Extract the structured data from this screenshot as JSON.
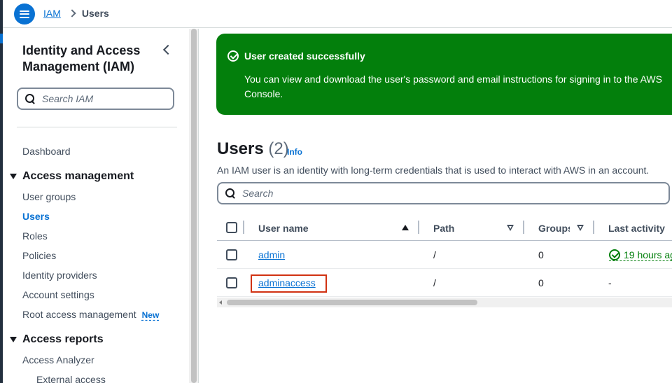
{
  "breadcrumb": {
    "root": "IAM",
    "current": "Users"
  },
  "sidebar": {
    "title": "Identity and Access Management (IAM)",
    "search_placeholder": "Search IAM",
    "dashboard": "Dashboard",
    "access_management": {
      "label": "Access management",
      "items": [
        "User groups",
        "Users",
        "Roles",
        "Policies",
        "Identity providers",
        "Account settings",
        "Root access management"
      ],
      "active": "Users",
      "new_badge": "New"
    },
    "access_reports": {
      "label": "Access reports",
      "items": [
        "Access Analyzer",
        "External access"
      ]
    }
  },
  "flash": {
    "title": "User created successfully",
    "body": "You can view and download the user's password and email instructions for signing in to the AWS Console.",
    "color": "#037f0c"
  },
  "users": {
    "title": "Users",
    "count": "(2)",
    "info": "Info",
    "description": "An IAM user is an identity with long-term credentials that is used to interact with AWS in an account.",
    "search_placeholder": "Search",
    "columns": [
      "User name",
      "Path",
      "Groups",
      "Last activity"
    ],
    "rows": [
      {
        "user_name": "admin",
        "path": "/",
        "groups": "0",
        "last_activity": "19 hours ag"
      },
      {
        "user_name": "adminaccess",
        "path": "/",
        "groups": "0",
        "last_activity": "-"
      }
    ]
  },
  "colors": {
    "accent": "#0972d3",
    "success": "#037f0c",
    "highlight": "#d13212"
  }
}
